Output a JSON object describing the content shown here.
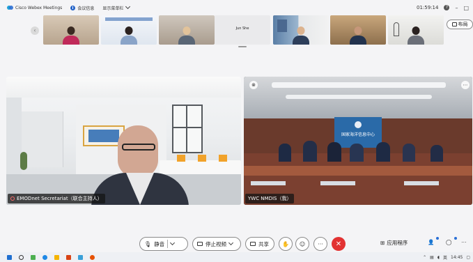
{
  "titlebar": {
    "app_title": "Cisco Webex Meetings",
    "meeting_info": "会议信息",
    "view_menu": "显示菜单栏",
    "timer": "01:59:14",
    "help": "?",
    "minimize": "–",
    "restore": "□"
  },
  "strip": {
    "thumbnails": [
      {
        "name": ""
      },
      {
        "name": ""
      },
      {
        "name": ""
      },
      {
        "name": "Jun She"
      },
      {
        "name": ""
      },
      {
        "name": ""
      },
      {
        "name": ""
      }
    ],
    "layout_label": "布局"
  },
  "tiles": {
    "left_name": "EMODnet Secretariat（联合主持人）",
    "right_name": "YWC NMDIS（我）",
    "banner_text": "国家海洋信息中心"
  },
  "controls": {
    "mute_label": "静音",
    "video_label": "停止视频",
    "share_label": "共享",
    "more": "···",
    "apps_label": "应用程序"
  },
  "taskbar": {
    "lang": "英",
    "time": "14:45"
  },
  "colors": {
    "accent": "#2564c8",
    "end_call": "#e23232",
    "webex_cyan": "#1ea1d6"
  }
}
